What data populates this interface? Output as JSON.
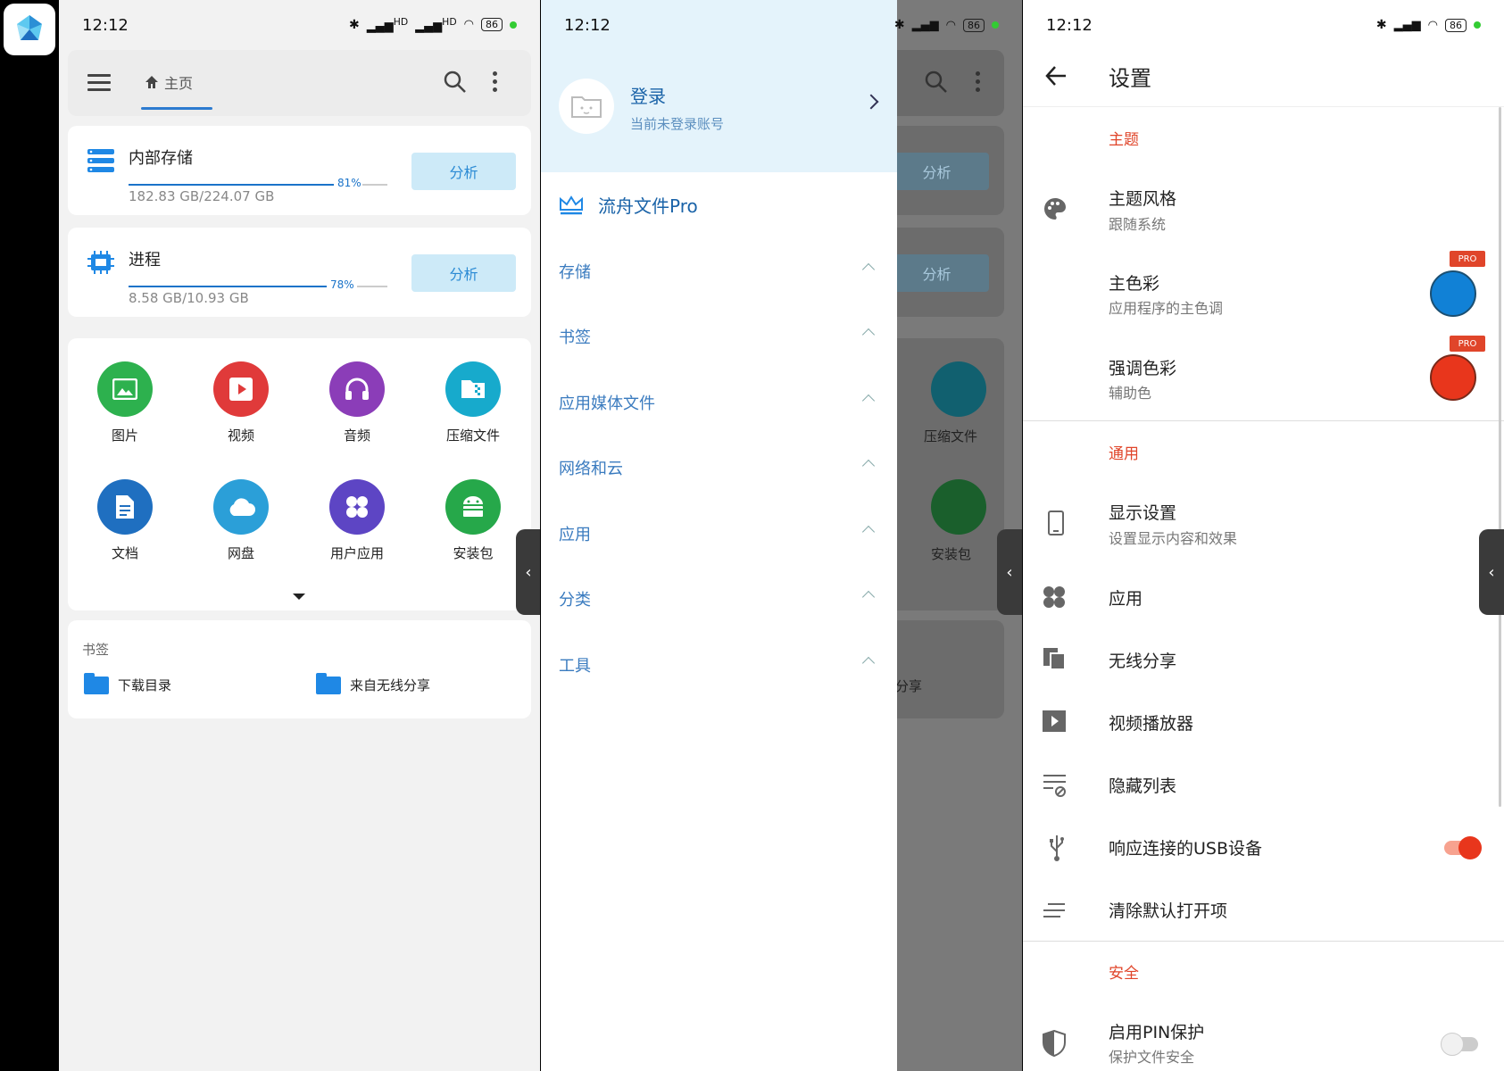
{
  "status": {
    "time": "12:12",
    "signal1": "HD",
    "signal2": "HD",
    "battery": "86"
  },
  "colors": {
    "accent": "#1a73c9",
    "danger": "#e0452a",
    "primary_swatch": "#1181d6",
    "accent_swatch": "#e8361c"
  },
  "home": {
    "breadcrumb": "主页",
    "storage": [
      {
        "title": "内部存储",
        "percent_label": "81%",
        "percent": 81,
        "usage": "182.83 GB/224.07 GB",
        "button": "分析"
      },
      {
        "title": "进程",
        "percent_label": "78%",
        "percent": 78,
        "usage": "8.58 GB/10.93 GB",
        "button": "分析"
      }
    ],
    "categories": [
      {
        "label": "图片",
        "icon": "image-icon",
        "color": "#2db14e"
      },
      {
        "label": "视频",
        "icon": "video-icon",
        "color": "#e03a3a"
      },
      {
        "label": "音频",
        "icon": "headphones-icon",
        "color": "#8b3db8"
      },
      {
        "label": "压缩文件",
        "icon": "archive-icon",
        "color": "#17aacc"
      },
      {
        "label": "文档",
        "icon": "document-icon",
        "color": "#1f6fc0"
      },
      {
        "label": "网盘",
        "icon": "cloud-icon",
        "color": "#2b9fd8"
      },
      {
        "label": "用户应用",
        "icon": "apps-icon",
        "color": "#5d45c4"
      },
      {
        "label": "安装包",
        "icon": "android-icon",
        "color": "#26a84a"
      }
    ],
    "bookmarks": {
      "title": "书签",
      "items": [
        "下载目录",
        "来自无线分享"
      ]
    }
  },
  "drawer": {
    "login_title": "登录",
    "login_sub": "当前未登录账号",
    "pro": "流舟文件Pro",
    "sections": [
      "存储",
      "书签",
      "应用媒体文件",
      "网络和云",
      "应用",
      "分类",
      "工具"
    ],
    "bg_button": "分析",
    "bg_archive": "压缩文件",
    "bg_apk": "安装包",
    "bg_share": "分享"
  },
  "settings": {
    "title": "设置",
    "group_theme": "主题",
    "theme_style": "主题风格",
    "theme_style_sub": "跟随系统",
    "primary_color": "主色彩",
    "primary_color_sub": "应用程序的主色调",
    "accent_color": "强调色彩",
    "accent_color_sub": "辅助色",
    "pro_badge": "PRO",
    "group_general": "通用",
    "display": "显示设置",
    "display_sub": "设置显示内容和效果",
    "apps": "应用",
    "wireless": "无线分享",
    "video_player": "视频播放器",
    "hidden_list": "隐藏列表",
    "usb": "响应连接的USB设备",
    "usb_enabled": true,
    "clear_defaults": "清除默认打开项",
    "group_security": "安全",
    "pin": "启用PIN保护",
    "pin_sub": "保护文件安全",
    "pin_enabled": false
  }
}
